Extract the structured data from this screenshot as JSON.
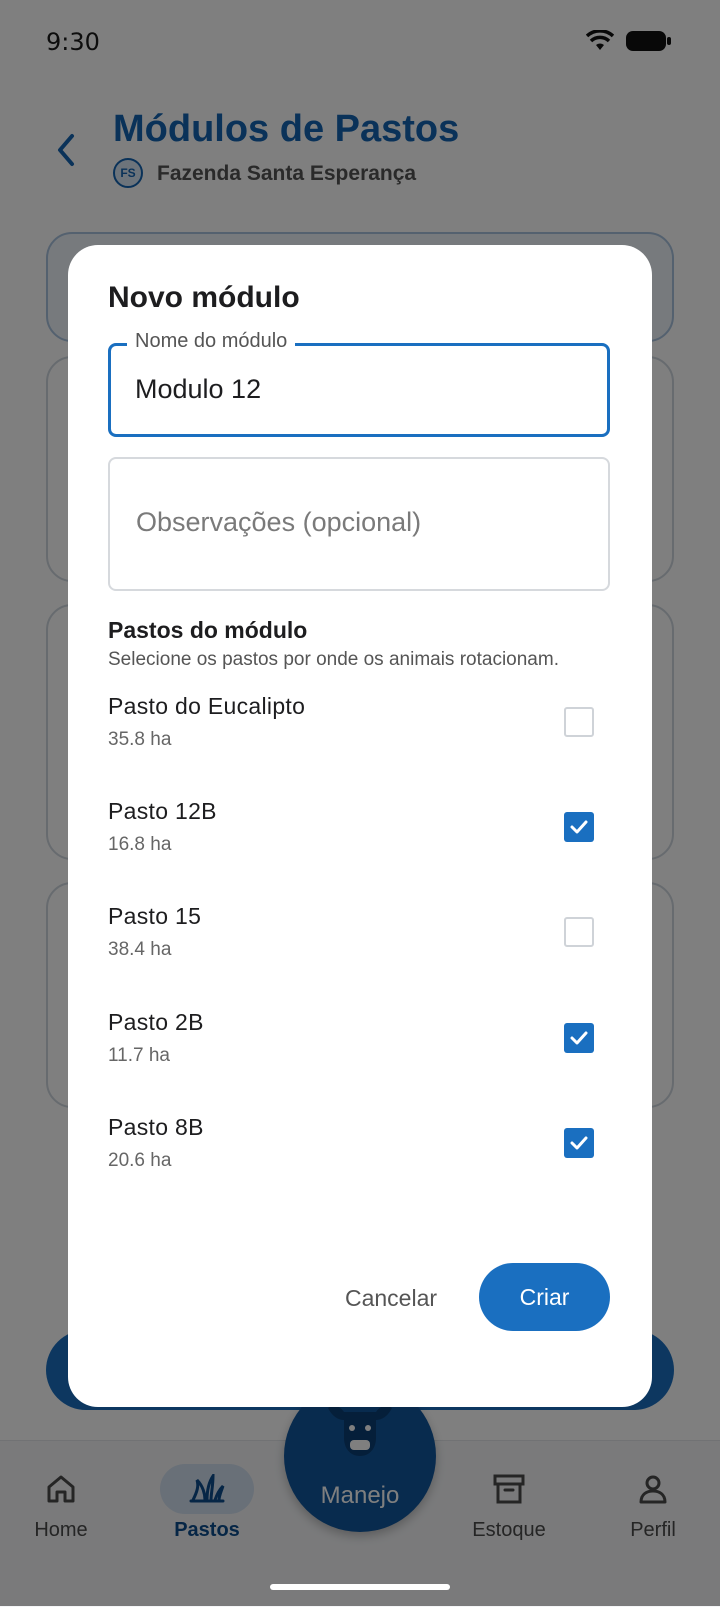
{
  "status_bar": {
    "time": "9:30"
  },
  "header": {
    "title": "Módulos de Pastos",
    "farm_initials": "FS",
    "farm_name": "Fazenda Santa Esperança"
  },
  "dialog": {
    "title": "Novo módulo",
    "name_field": {
      "label": "Nome do módulo",
      "value": "Modulo 12"
    },
    "obs_field": {
      "placeholder": "Observações (opcional)"
    },
    "section_title": "Pastos do módulo",
    "section_subtitle": "Selecione os pastos por onde os animais rotacionam.",
    "pastures": [
      {
        "name": "Pasto do Eucalipto",
        "area": "35.8 ha",
        "checked": false
      },
      {
        "name": "Pasto 12B",
        "area": "16.8 ha",
        "checked": true
      },
      {
        "name": "Pasto 15",
        "area": "38.4 ha",
        "checked": false
      },
      {
        "name": "Pasto 2B",
        "area": "11.7 ha",
        "checked": true
      },
      {
        "name": "Pasto 8B",
        "area": "20.6 ha",
        "checked": true
      }
    ],
    "cancel_label": "Cancelar",
    "create_label": "Criar"
  },
  "bottom_nav": {
    "home": "Home",
    "pastos": "Pastos",
    "manejo": "Manejo",
    "estoque": "Estoque",
    "perfil": "Perfil",
    "active": "pastos"
  },
  "colors": {
    "primary": "#1a6fc0",
    "title_blue": "#1565b3",
    "manejo_bg": "#11569c"
  }
}
